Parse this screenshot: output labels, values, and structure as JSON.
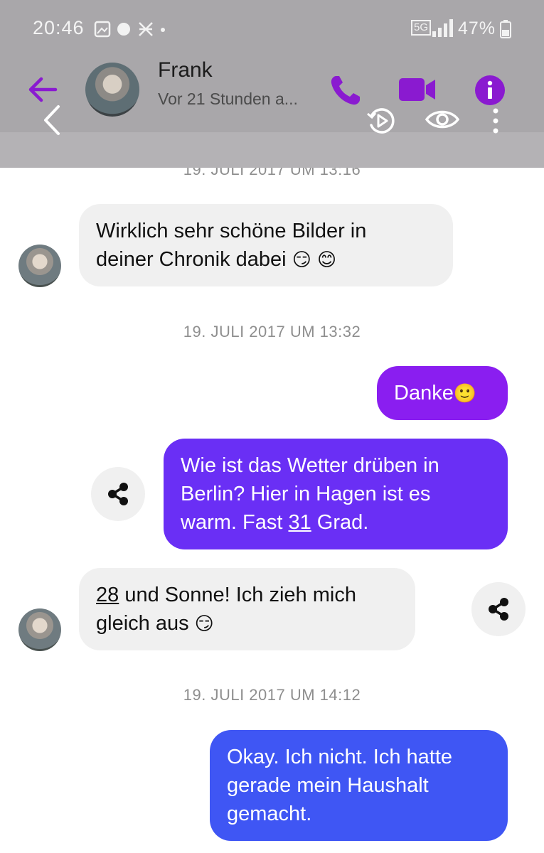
{
  "status_bar": {
    "time": "20:46",
    "battery": "47%",
    "network": "5G"
  },
  "header": {
    "contact_name": "Frank",
    "contact_status": "Vor 21 Stunden a...",
    "icons": [
      "back-arrow-icon",
      "phone-icon",
      "video-icon",
      "info-icon"
    ]
  },
  "overlay_controls": [
    "chevron-left-icon",
    "replay-icon",
    "eye-icon",
    "more-vertical-icon"
  ],
  "colors": {
    "accent": "#8a1ad0",
    "incoming_bubble": "#f0f0f0",
    "outgoing_purple": "#8a1ef0",
    "outgoing_violet": "#6a2ff5",
    "outgoing_blue": "#3f56f4"
  },
  "conversation": {
    "timestamp_1": "19. JULI 2017 UM 13:16",
    "msg_1": {
      "line1": "Wirklich sehr schöne Bilder in",
      "line2": "deiner Chronik dabei",
      "emoji": "😏 😊"
    },
    "timestamp_2": "19. JULI 2017 UM 13:32",
    "msg_2": {
      "text": "Danke",
      "emoji": "🙂"
    },
    "msg_3": {
      "line1": "Wie ist das Wetter drüben in",
      "line2": "Berlin? Hier in Hagen ist es",
      "line3_pre": "warm. Fast ",
      "line3_num": "31",
      "line3_post": " Grad."
    },
    "msg_4": {
      "line1_num": "28",
      "line1_post": " und Sonne! Ich zieh mich",
      "line2": "gleich aus",
      "emoji": "😏"
    },
    "timestamp_3": "19. JULI 2017 UM 14:12",
    "msg_5": {
      "line1": "Okay. Ich nicht. Ich hatte",
      "line2": "gerade mein Haushalt",
      "line3": "gemacht."
    }
  }
}
